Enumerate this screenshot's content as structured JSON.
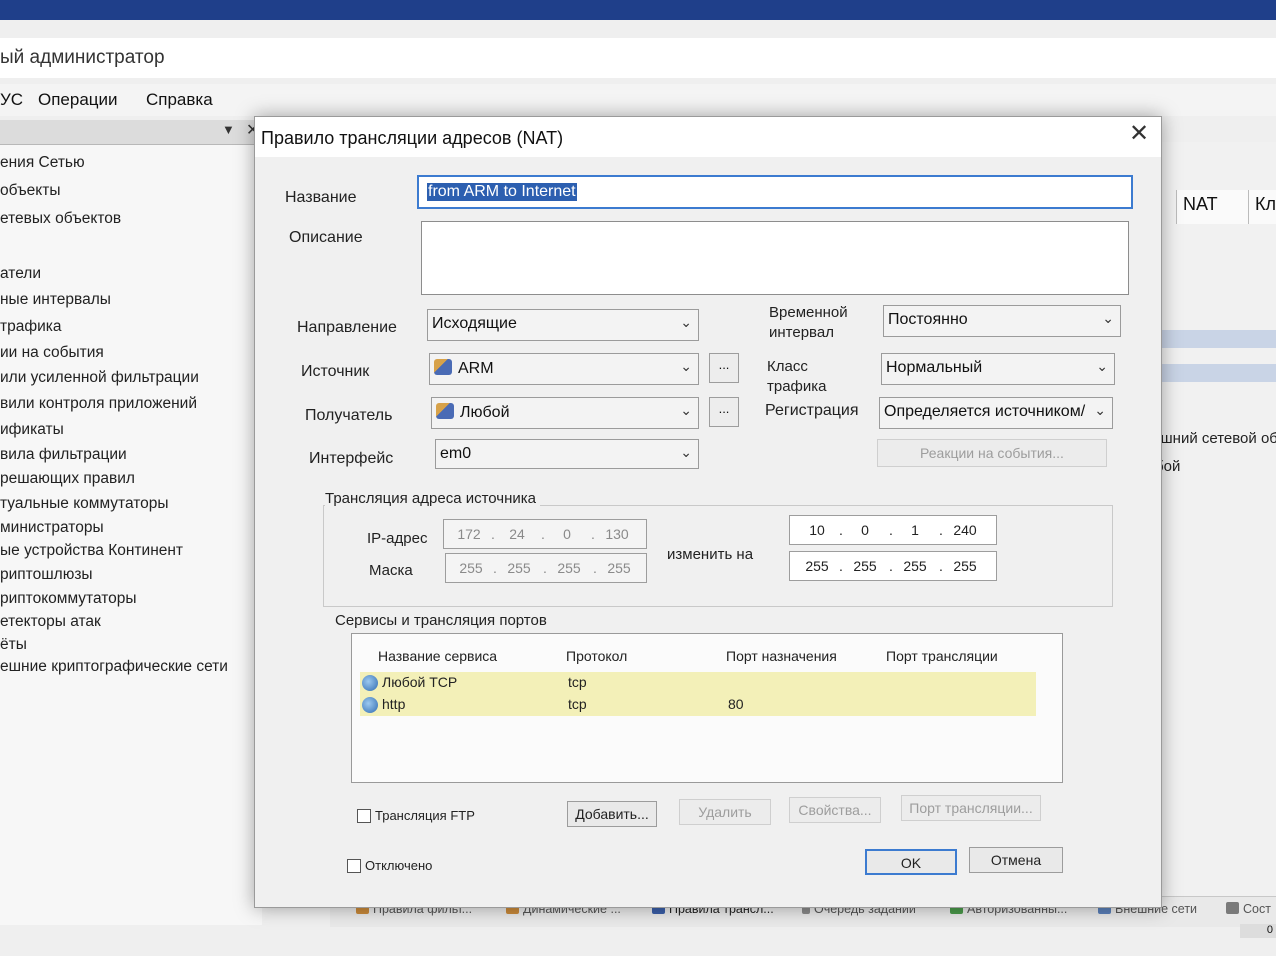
{
  "app": {
    "title": "ый администратор",
    "menu": [
      "УС",
      "Операции",
      "Справка"
    ],
    "tree_items": [
      "ения Сетью",
      "объекты",
      "етевых объектов",
      "атели",
      "ные интервалы",
      "трафика",
      "ии на события",
      "или усиленной фильтрации",
      "вили контроля приложений",
      "ификаты",
      "вила фильтрации",
      "решающих правил",
      "туальные коммутаторы",
      "министраторы",
      "ые устройства Континент",
      "риптошлюзы",
      "риптокоммутаторы",
      "етекторы атак",
      "ёты",
      "ешние криптографические сети"
    ],
    "right_headers": [
      "NAT",
      "Кл"
    ],
    "right_cells": [
      "Внешний сетевой об",
      "Любой"
    ],
    "taskbar_tabs": [
      "Правила фильт...",
      "Динамические ...",
      "Правила трансл...",
      "Очередь заданий",
      "Авторизованны...",
      "Внешние сети",
      "Сост"
    ],
    "status_number": "0"
  },
  "dialog": {
    "title": "Правило трансляции адресов (NAT)",
    "name_label": "Название",
    "name_value": "from ARM to Internet",
    "description_label": "Описание",
    "description_value": "",
    "direction_label": "Направление",
    "direction_value": "Исходящие",
    "source_label": "Источник",
    "source_value": "ARM",
    "recipient_label": "Получатель",
    "recipient_value": "Любой",
    "interface_label": "Интерфейс",
    "interface_value": "em0",
    "time_interval_label": [
      "Временной",
      "интервал"
    ],
    "time_interval_value": "Постоянно",
    "traffic_class_label": [
      "Класс",
      "трафика"
    ],
    "traffic_class_value": "Нормальный",
    "registration_label": "Регистрация",
    "registration_value": "Определяется источником/",
    "reactions_button": "Реакции на события...",
    "dots_button": "...",
    "source_translation": {
      "group_label": "Трансляция адреса источника",
      "ip_label": "IP-адрес",
      "mask_label": "Маска",
      "change_to_label": "изменить на",
      "ip_octets": [
        "172",
        "24",
        "0",
        "130"
      ],
      "mask_octets": [
        "255",
        "255",
        "255",
        "255"
      ],
      "new_ip_octets": [
        "10",
        "0",
        "1",
        "240"
      ],
      "new_mask_octets": [
        "255",
        "255",
        "255",
        "255"
      ]
    },
    "services": {
      "group_label": "Сервисы и трансляция портов",
      "columns": [
        "Название сервиса",
        "Протокол",
        "Порт назначения",
        "Порт трансляции"
      ],
      "rows": [
        {
          "name": "Любой TCP",
          "protocol": "tcp",
          "dest_port": "",
          "trans_port": ""
        },
        {
          "name": "http",
          "protocol": "tcp",
          "dest_port": "80",
          "trans_port": ""
        }
      ]
    },
    "ftp_label": "Трансляция FTP",
    "add_button": "Добавить...",
    "delete_button": "Удалить",
    "properties_button": "Свойства...",
    "port_translation_button": "Порт трансляции...",
    "disabled_label": "Отключено",
    "ok_button": "OK",
    "cancel_button": "Отмена",
    "close_icon": "close-icon"
  }
}
